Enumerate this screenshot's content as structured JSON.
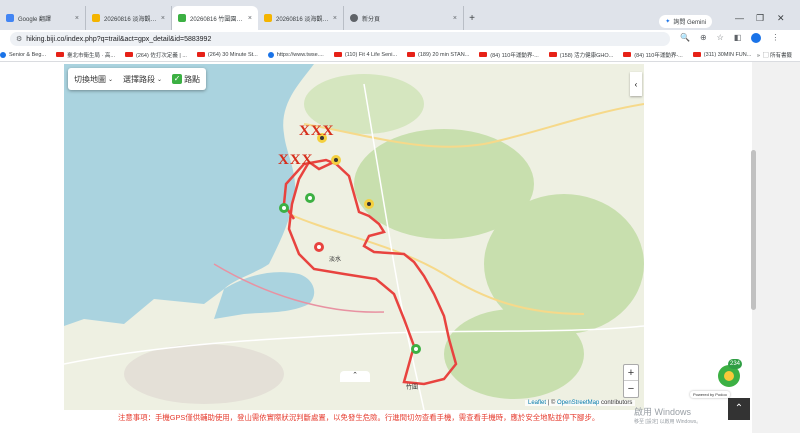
{
  "tabs": [
    {
      "label": "Google 翻譯",
      "color": "#4285f4",
      "active": false
    },
    {
      "label": "20260816 淡海觀觀紅樓桿...",
      "color": "#f4b400",
      "active": false
    },
    {
      "label": "20260816 竹圍園小(淡海觀觀...",
      "color": "#3cb043",
      "active": true
    },
    {
      "label": "20260816 淡海觀觀紅樓桿...",
      "color": "#f4b400",
      "active": false
    },
    {
      "label": "新分頁",
      "color": "#5f6368",
      "active": false
    }
  ],
  "gemini_label": "詢問 Gemini",
  "address": {
    "url": "hiking.biji.co/index.php?q=trail&act=gpx_detail&id=5883992"
  },
  "bookmarks": [
    {
      "label": "Senior & Beg...",
      "icon": "web"
    },
    {
      "label": "臺北市衛生局 · 高...",
      "icon": "youtube"
    },
    {
      "label": "(264) 佐打次定義 | ...",
      "icon": "youtube"
    },
    {
      "label": "(264) 30 Minute St...",
      "icon": "youtube"
    },
    {
      "label": "https://www.twse....",
      "icon": "web"
    },
    {
      "label": "(110) Fit 4 Life Seni...",
      "icon": "youtube"
    },
    {
      "label": "(189) 20 min STAN...",
      "icon": "youtube"
    },
    {
      "label": "(84) 110年運動界-...",
      "icon": "youtube"
    },
    {
      "label": "(158) 活力健康GHO...",
      "icon": "youtube"
    },
    {
      "label": "(84) 110年運動界-...",
      "icon": "youtube"
    },
    {
      "label": "(311) 30MIN FUN...",
      "icon": "youtube"
    }
  ],
  "bookmarks_all": "所有書籤",
  "map_toolbar": {
    "switch_map": "切換地圖",
    "select_route": "選擇路段",
    "trail_points": "路點"
  },
  "map_overlay": {
    "xxx_top": "XXX",
    "xxx_left": "XXX"
  },
  "map_labels": [
    "淡水",
    "竹圍"
  ],
  "attribution": {
    "leaflet": "Leaflet",
    "sep": " | © ",
    "osm": "OpenStreetMap",
    "contrib": " contributors"
  },
  "zoom": {
    "in": "+",
    "out": "−"
  },
  "notice": "注意事項：手機GPS僅供輔助使用，登山需依實際狀況判斷處置，以免發生危險。行進間切勿查看手機，需查看手機時，應於安全地點並停下腳步。",
  "chat": {
    "badge": "234",
    "powered": "Powered by Podoo"
  },
  "watermark": {
    "line1": "啟用 Windows",
    "line2": "移至 [設定] 以啟用 Windows。"
  },
  "colors": {
    "route": "#e8433f",
    "sea": "#aad3df",
    "land": "#eef0e2",
    "forest": "#c8dfae"
  }
}
